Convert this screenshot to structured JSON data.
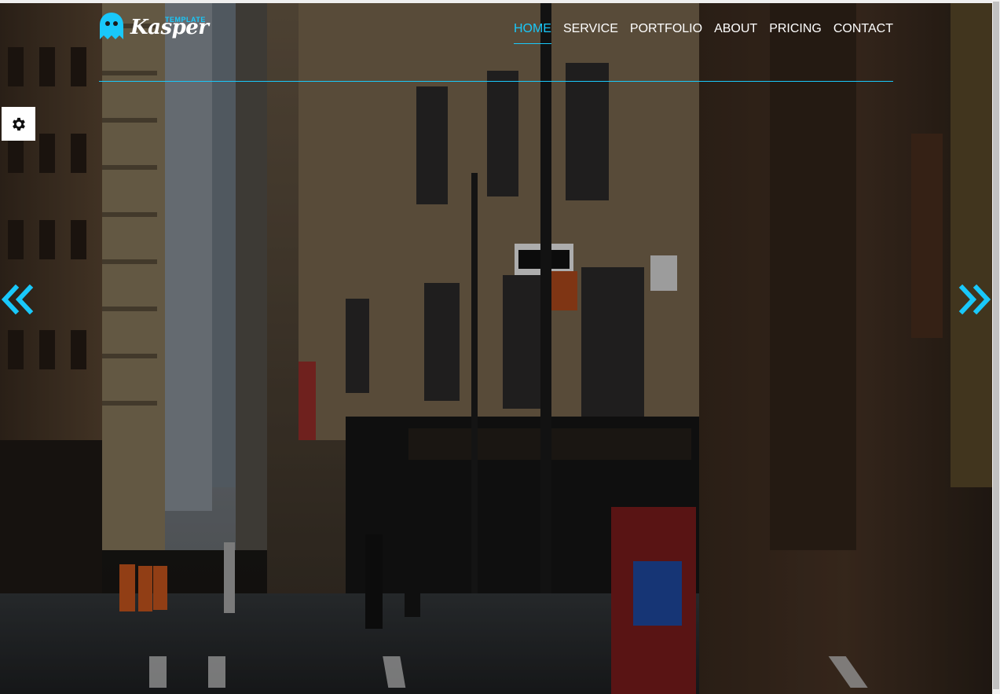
{
  "logo": {
    "small_text": "TEMPLATE",
    "brand_text": "Kasper"
  },
  "nav": {
    "items": [
      {
        "label": "HOME",
        "active": true
      },
      {
        "label": "SERVICE",
        "active": false
      },
      {
        "label": "PORTFOLIO",
        "active": false
      },
      {
        "label": "ABOUT",
        "active": false
      },
      {
        "label": "PRICING",
        "active": false
      },
      {
        "label": "CONTACT",
        "active": false
      }
    ]
  },
  "controls": {
    "settings_icon": "gear-icon",
    "prev_icon": "double-chevron-left-icon",
    "next_icon": "double-chevron-right-icon"
  },
  "colors": {
    "accent": "#19c8fa",
    "text": "#ffffff",
    "overlay": "rgba(0,0,0,0.28)"
  }
}
